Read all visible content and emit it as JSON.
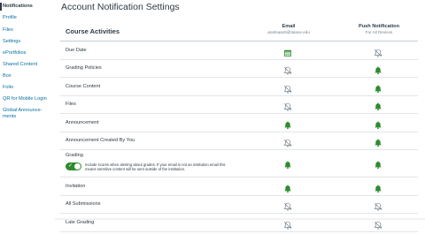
{
  "sidebar": {
    "items": [
      {
        "label": "Notifications",
        "active": true
      },
      {
        "label": "Profile"
      },
      {
        "label": "Files"
      },
      {
        "label": "Settings"
      },
      {
        "label": "ePortfolios"
      },
      {
        "label": "Shared Content"
      },
      {
        "label": "Box"
      },
      {
        "label": "Folio"
      },
      {
        "label": "QR for Mobile Login"
      },
      {
        "label": "Global Announce-"
      },
      {
        "label": "ments"
      }
    ]
  },
  "page": {
    "title": "Account Notification Settings"
  },
  "table": {
    "section_title": "Course Activities",
    "email_header": "Email",
    "email_sub": "aralmaan5@tulane.edu",
    "push_header": "Push Notification",
    "push_sub": "For All Devices",
    "rows": [
      {
        "label": "Due Date",
        "email": "calendar-icon",
        "push": "bell-off-icon"
      },
      {
        "label": "Grading Policies",
        "email": "bell-off-icon",
        "push": "bell-icon"
      },
      {
        "label": "Course Content",
        "email": "bell-off-icon",
        "push": "bell-icon"
      },
      {
        "label": "Files",
        "email": "bell-off-icon",
        "push": "bell-icon"
      },
      {
        "label": "Announcement",
        "email": "bell-icon",
        "push": "bell-icon"
      },
      {
        "label": "Announcement Created By You",
        "email": "bell-off-icon",
        "push": "bell-icon"
      },
      {
        "label": "Grading",
        "email": "bell-icon",
        "push": "bell-icon"
      },
      {
        "label": "Invitation",
        "email": "bell-icon",
        "push": "bell-icon"
      },
      {
        "label": "All Submissions",
        "email": "bell-off-icon",
        "push": "bell-off-icon"
      },
      {
        "label": "Late Grading",
        "email": "bell-off-icon",
        "push": "bell-off-icon"
      }
    ],
    "grading_desc": "Include scores when alerting about grades. If your email is not an institution email this means sensitive content will be sent outside of the institution."
  },
  "colors": {
    "green": "#2e8c2e",
    "gray": "#73818b",
    "link": "#0770a3"
  }
}
